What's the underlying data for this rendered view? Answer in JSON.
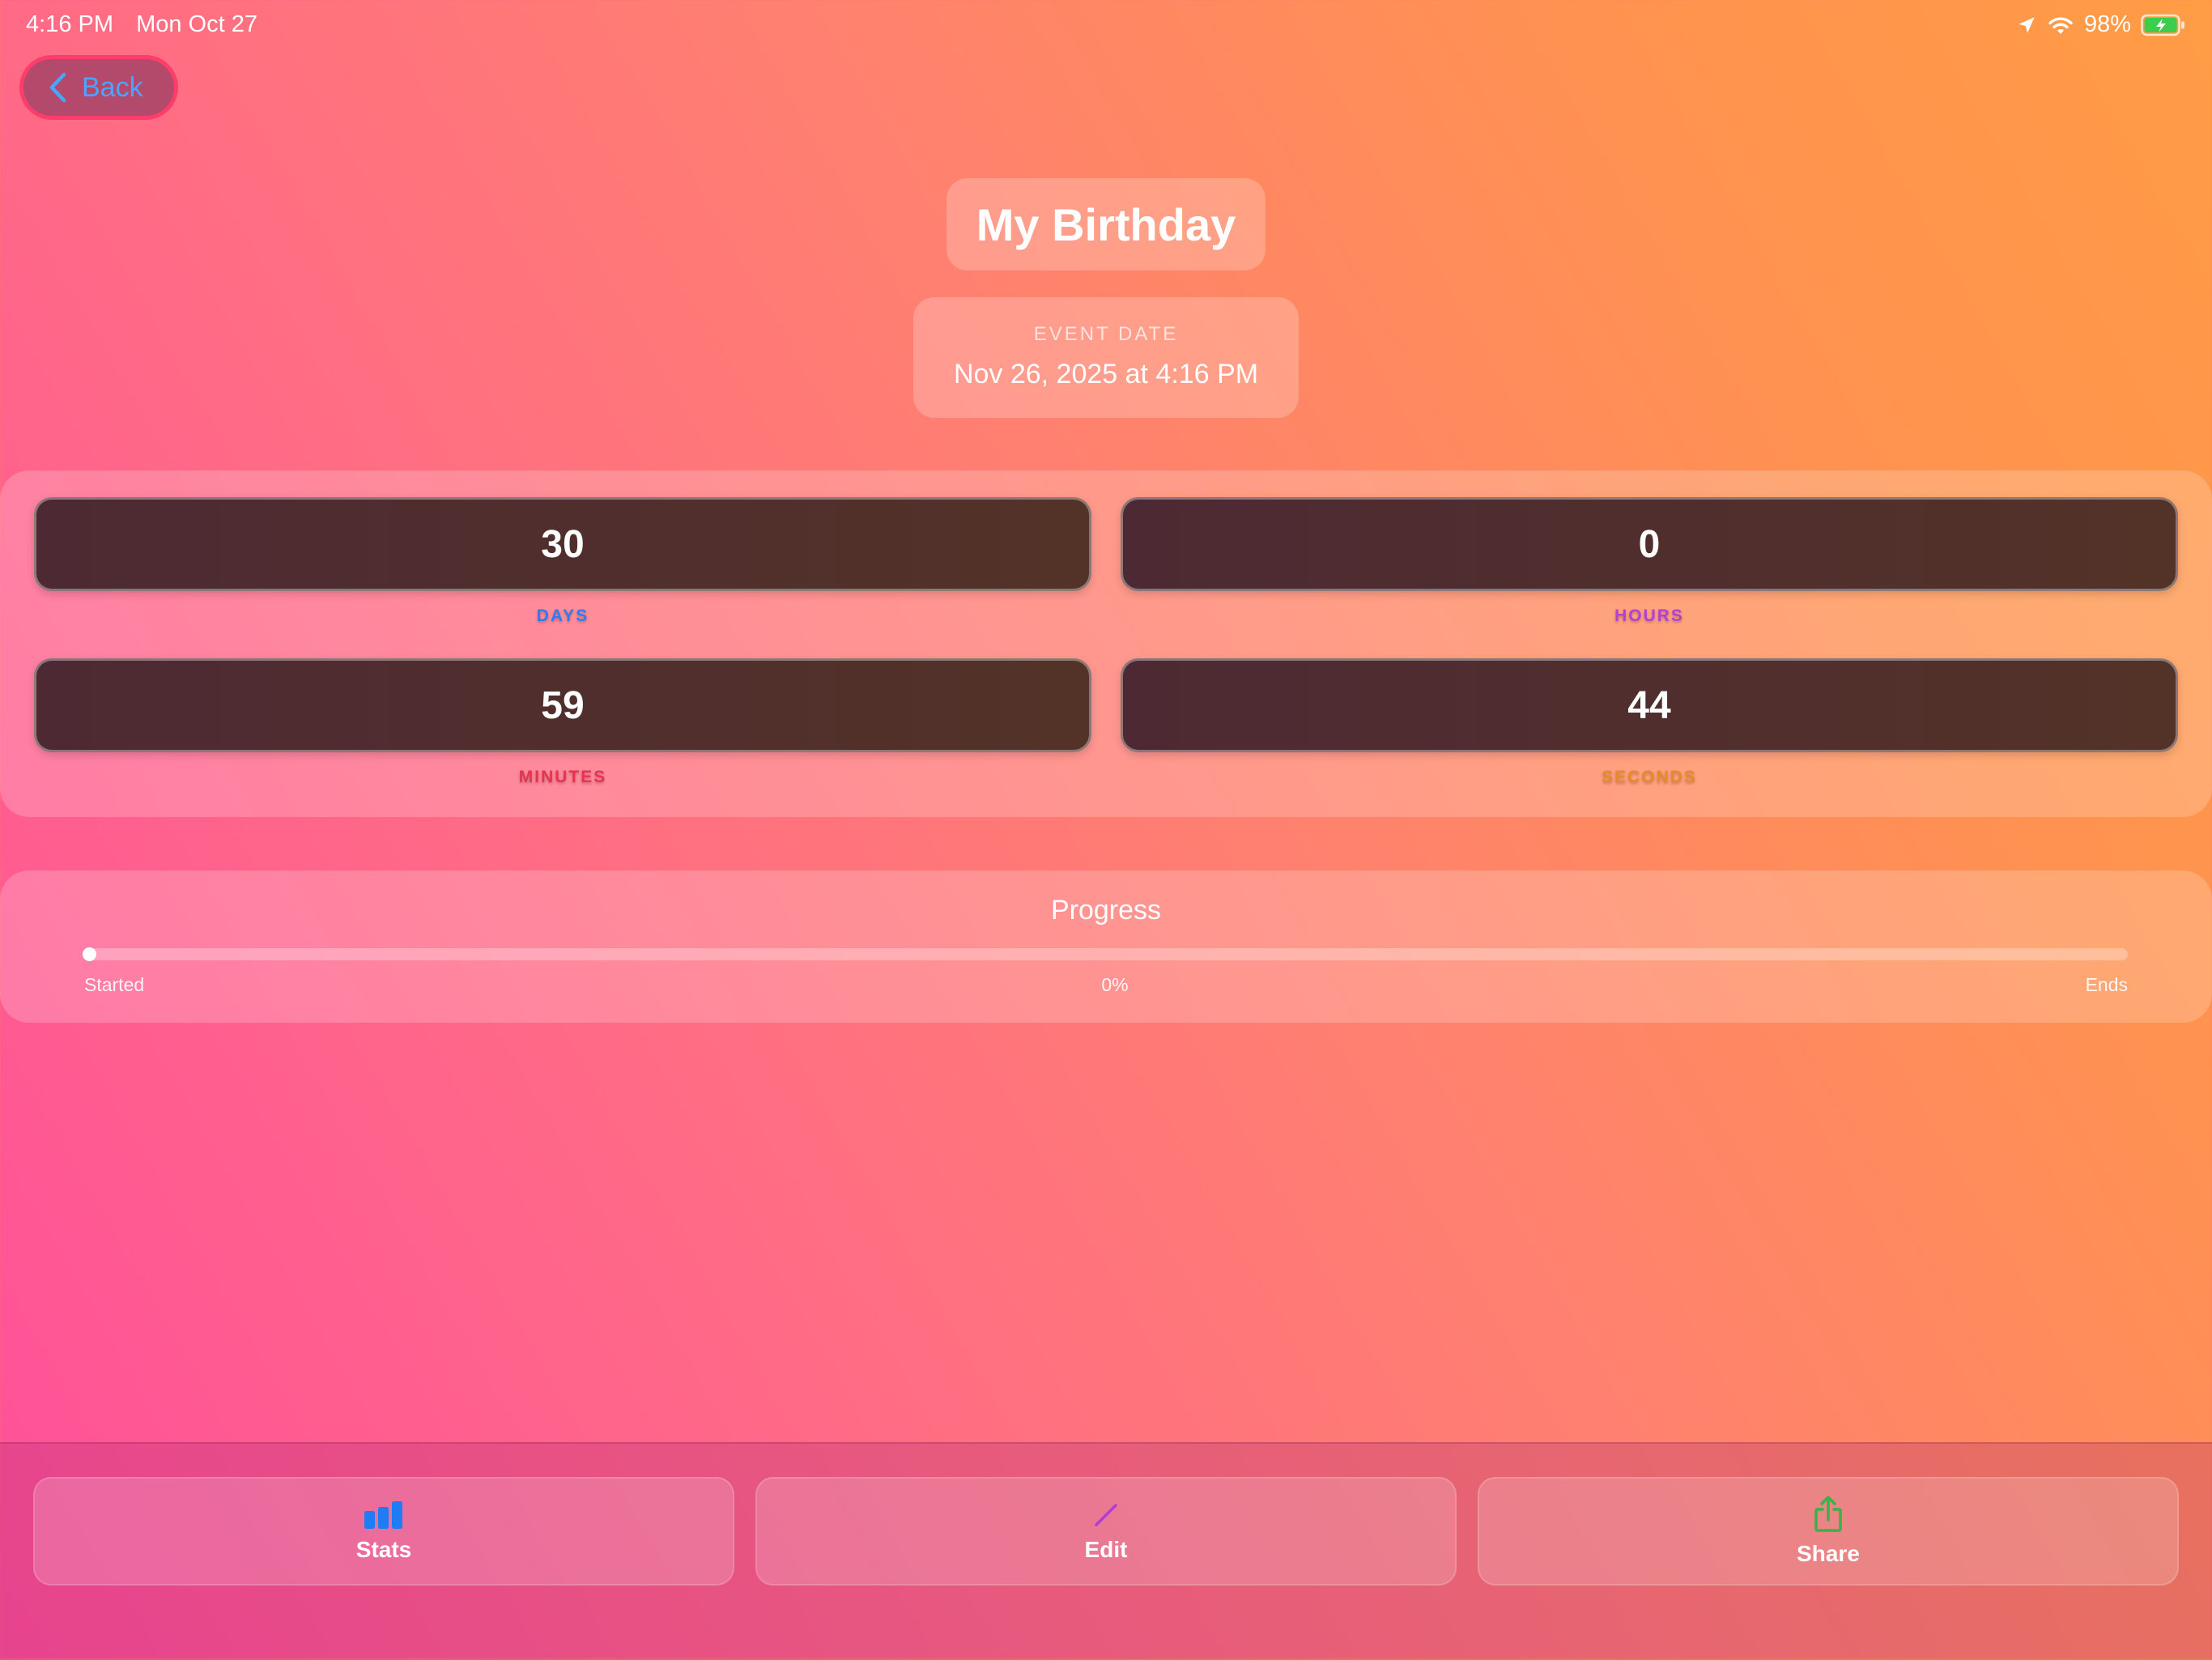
{
  "status_bar": {
    "time": "4:16 PM",
    "date": "Mon Oct 27",
    "battery": "98%",
    "icons": [
      "location-arrow-icon",
      "wifi-icon",
      "battery-charging-icon"
    ]
  },
  "nav": {
    "back_label": "Back"
  },
  "event": {
    "title": "My Birthday",
    "date_caption": "EVENT DATE",
    "date_value": "Nov 26, 2025 at 4:16 PM"
  },
  "countdown": [
    {
      "value": "30",
      "unit": "DAYS",
      "color": "#2f7bf0"
    },
    {
      "value": "0",
      "unit": "HOURS",
      "color": "#b43fd4"
    },
    {
      "value": "59",
      "unit": "MINUTES",
      "color": "#e8324f"
    },
    {
      "value": "44",
      "unit": "SECONDS",
      "color": "#e88a25"
    }
  ],
  "progress": {
    "title": "Progress",
    "start_label": "Started",
    "percent_label": "0%",
    "end_label": "Ends",
    "value": 0
  },
  "toolbar": {
    "buttons": [
      {
        "label": "Stats",
        "icon": "bar-chart-icon",
        "color": "#1f7cf2"
      },
      {
        "label": "Edit",
        "icon": "pencil-icon",
        "color": "#b13cd6"
      },
      {
        "label": "Share",
        "icon": "share-icon",
        "color": "#38b24a"
      }
    ]
  },
  "colors": {
    "accent_blue": "#4da3ff",
    "back_border": "#ff3d6a",
    "background_start": "#ff4f9a",
    "background_end": "#ff9c45"
  }
}
